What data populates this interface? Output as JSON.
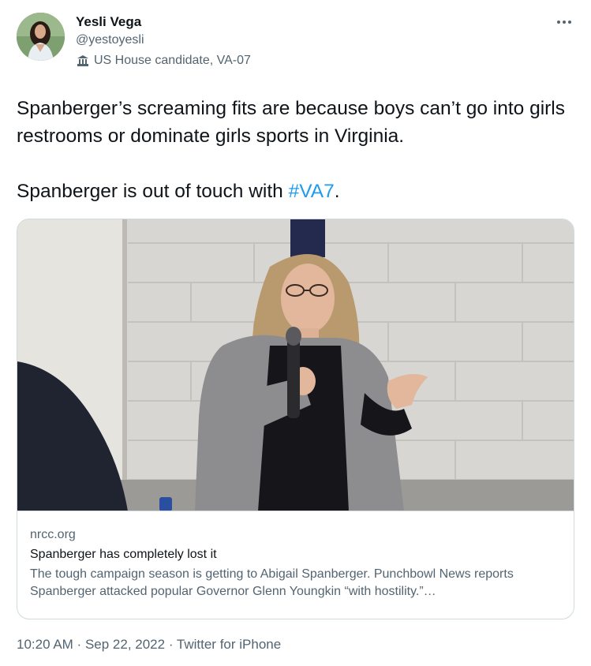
{
  "author": {
    "display_name": "Yesli Vega",
    "handle": "@yestoyesli",
    "label": "US House candidate, VA-07",
    "label_icon": "government-building-icon",
    "avatar_icon": "avatar"
  },
  "menu": {
    "icon": "more-options-icon"
  },
  "tweet": {
    "line1": "Spanberger’s screaming fits are because boys can’t go into girls restrooms or dominate girls sports in Virginia.",
    "line2_prefix": "Spanberger is out of touch with ",
    "hashtag": "#VA7",
    "line2_suffix": "."
  },
  "card": {
    "domain": "nrcc.org",
    "title": "Spanberger has completely lost it",
    "description": "The tough campaign season is getting to Abigail Spanberger. Punchbowl News reports Spanberger attacked popular Governor Glenn Youngkin “with hostility.”…"
  },
  "footer": {
    "time": "10:20 AM",
    "separator": " · ",
    "date": "Sep 22, 2022",
    "separator2": " · ",
    "source": "Twitter for iPhone"
  },
  "colors": {
    "accent": "#1d9bf0",
    "secondary_text": "#536471",
    "primary_text": "#0f1419",
    "border": "#cfd9de"
  }
}
